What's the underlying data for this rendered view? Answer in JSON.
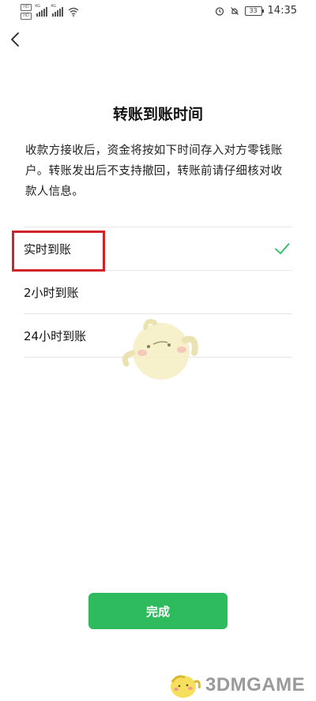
{
  "status_bar": {
    "hd1": "HD",
    "hd2": "HD",
    "net1": "4G",
    "net2": "4G",
    "battery": "33",
    "time": "14:35"
  },
  "page": {
    "title": "转账到账时间",
    "description": "收款方接收后，资金将按如下时间存入对方零钱账户。转账发出后不支持撤回，转账前请仔细核对收款人信息。"
  },
  "options": [
    {
      "label": "实时到账",
      "selected": true
    },
    {
      "label": "2小时到账",
      "selected": false
    },
    {
      "label": "24小时到账",
      "selected": false
    }
  ],
  "done_button": {
    "label": "完成"
  },
  "watermark": {
    "text": "3DMGAME"
  },
  "colors": {
    "accent": "#2dbb5e",
    "highlight": "#d2232a"
  }
}
